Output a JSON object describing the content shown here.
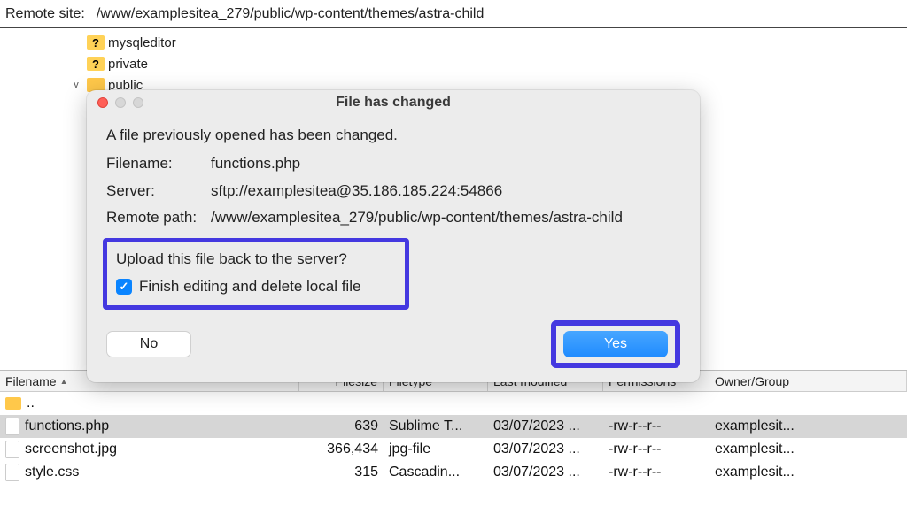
{
  "remote_site": {
    "label": "Remote site:",
    "path": "/www/examplesitea_279/public/wp-content/themes/astra-child"
  },
  "tree": {
    "items": [
      {
        "name": "mysqleditor",
        "icon": "folder-q"
      },
      {
        "name": "private",
        "icon": "folder-q"
      },
      {
        "name": "public",
        "icon": "folder",
        "expander": "v"
      }
    ]
  },
  "file_list": {
    "headers": {
      "name": "Filename",
      "size": "Filesize",
      "type": "Filetype",
      "modified": "Last modified",
      "permissions": "Permissions",
      "owner": "Owner/Group"
    },
    "rows": [
      {
        "name": "..",
        "kind": "parent"
      },
      {
        "name": "functions.php",
        "kind": "file",
        "size": "639",
        "type": "Sublime T...",
        "modified": "03/07/2023 ...",
        "permissions": "-rw-r--r--",
        "owner": "examplesit...",
        "selected": true
      },
      {
        "name": "screenshot.jpg",
        "kind": "file",
        "size": "366,434",
        "type": "jpg-file",
        "modified": "03/07/2023 ...",
        "permissions": "-rw-r--r--",
        "owner": "examplesit..."
      },
      {
        "name": "style.css",
        "kind": "file",
        "size": "315",
        "type": "Cascadin...",
        "modified": "03/07/2023 ...",
        "permissions": "-rw-r--r--",
        "owner": "examplesit..."
      }
    ]
  },
  "dialog": {
    "title": "File has changed",
    "message": "A file previously opened has been changed.",
    "fields": {
      "filename_label": "Filename:",
      "filename_value": "functions.php",
      "server_label": "Server:",
      "server_value": "sftp://examplesitea@35.186.185.224:54866",
      "path_label": "Remote path:",
      "path_value": "/www/examplesitea_279/public/wp-content/themes/astra-child"
    },
    "upload_prompt": "Upload this file back to the server?",
    "finish_checkbox_label": "Finish editing and delete local file",
    "finish_checkbox_checked": true,
    "buttons": {
      "no": "No",
      "yes": "Yes"
    }
  }
}
